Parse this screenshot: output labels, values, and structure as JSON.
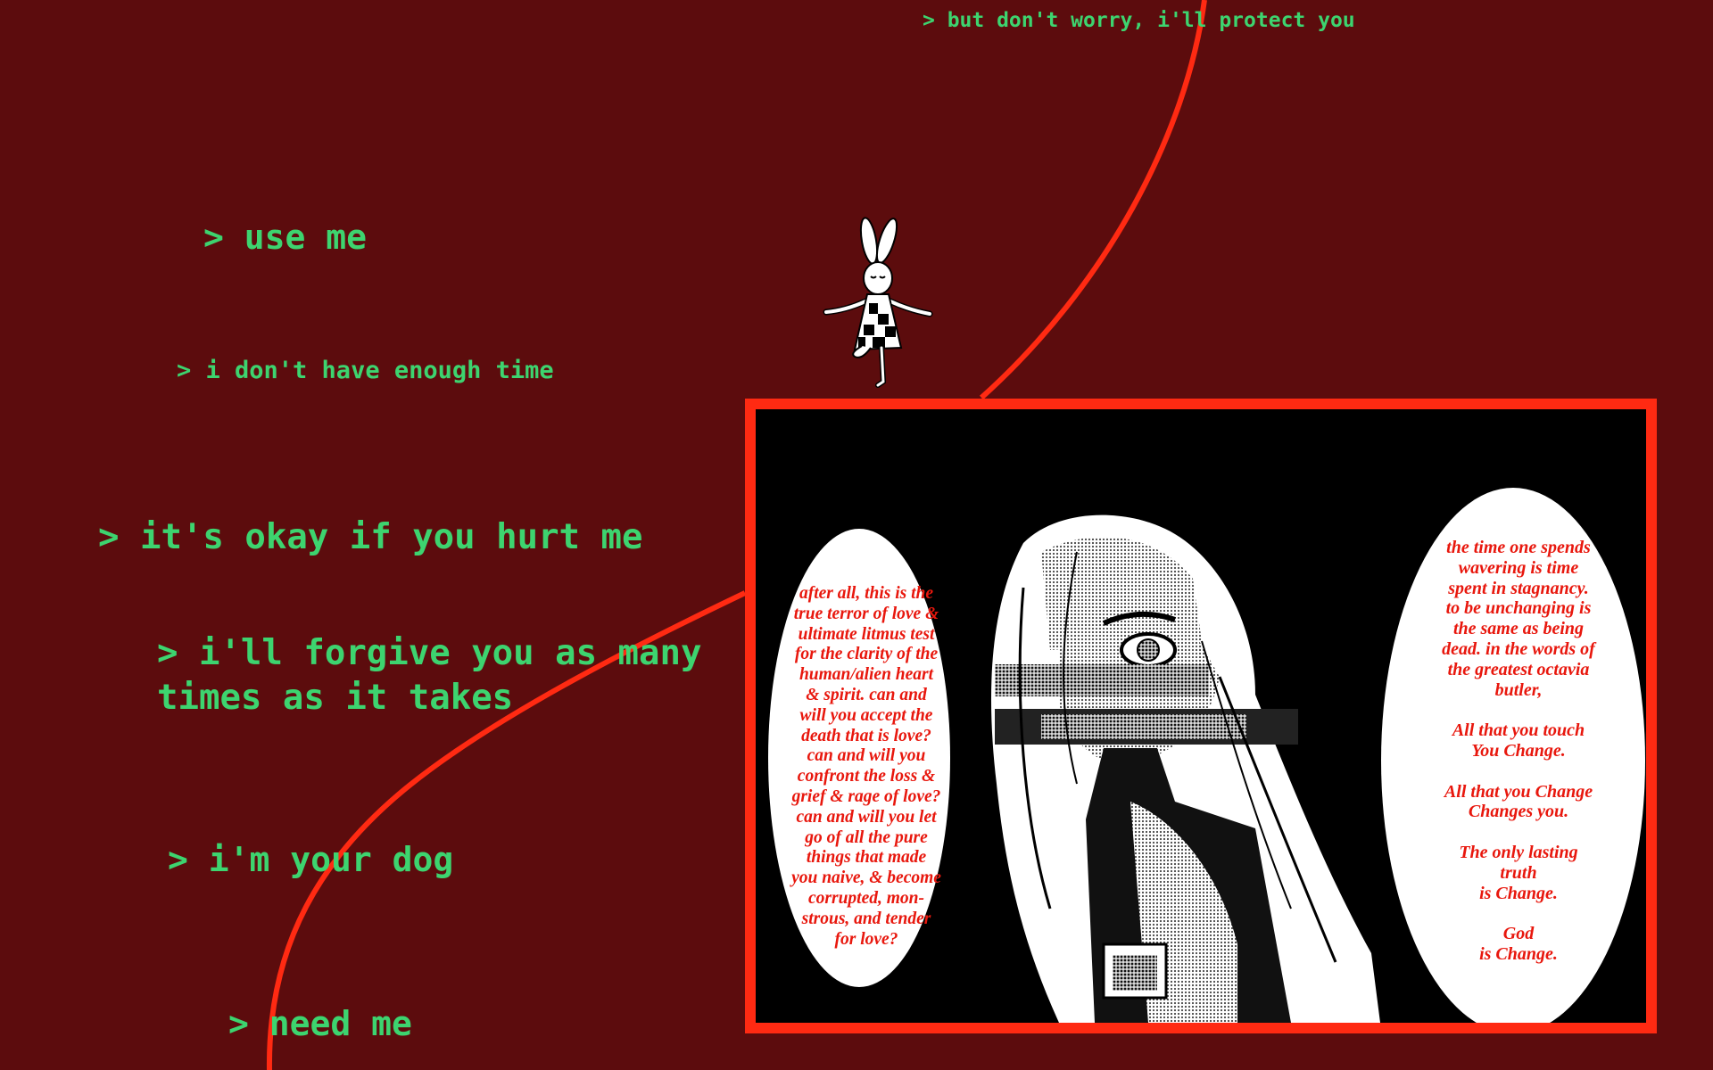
{
  "colors": {
    "background": "#5c0c0d",
    "text_green": "#3dd46f",
    "accent_red": "#ff2a12",
    "bubble_text_red": "#e8170d"
  },
  "lines": {
    "protect": "> but don't worry, i'll protect you",
    "use_me": "> use me",
    "no_time": "> i don't have enough time",
    "hurt": "> it's okay if you hurt me",
    "forgive": "> i'll forgive you as many\ntimes as it takes",
    "dog": "> i'm your dog",
    "need": "> need me"
  },
  "panel": {
    "left_bubble_text": "after all, this is the\ntrue terror of love &\nultimate litmus test\nfor the clarity of the\nhuman/alien heart\n& spirit. can and\nwill you accept the\ndeath that is love?\ncan and will you\nconfront the loss &\ngrief & rage of love?\ncan and will you let\ngo of all the pure\nthings that made\nyou naive, & become\ncorrupted, mon-\nstrous, and tender\nfor love?",
    "right_bubble_text": "the time one spends\nwavering is time\nspent in stagnancy.\nto be unchanging is\nthe same as being\ndead. in the words of\nthe greatest octavia\nbutler,\n\nAll that you touch\nYou Change.\n\nAll that you Change\nChanges you.\n\nThe only lasting\ntruth\nis Change.\n\nGod\nis Change."
  },
  "icons": {
    "bunny": "bunny-figure-icon",
    "manga_character": "manga-character-illustration"
  }
}
